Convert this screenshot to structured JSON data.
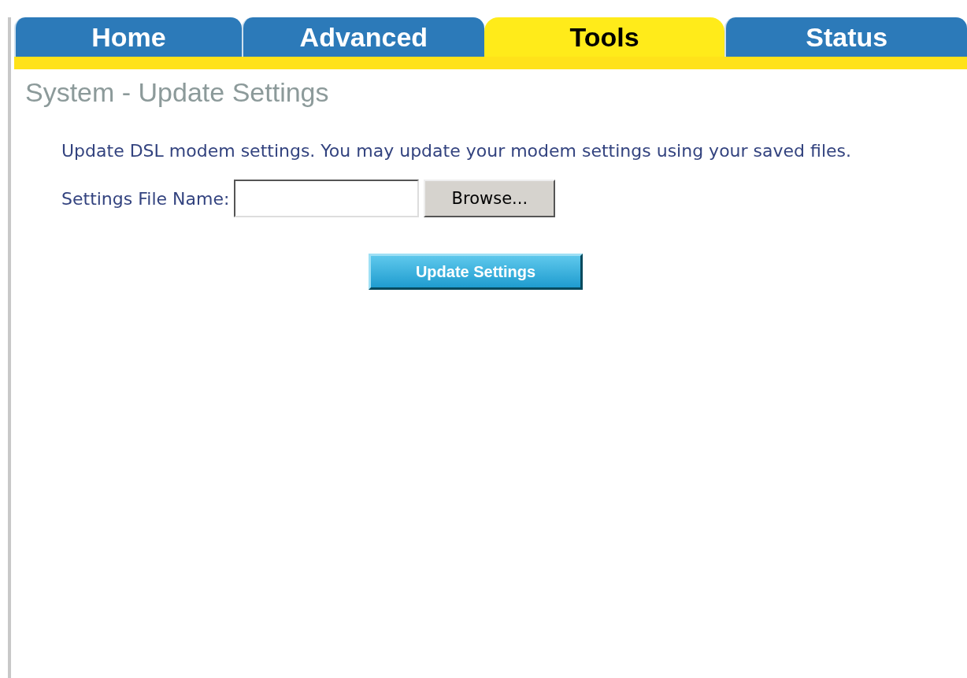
{
  "tabs": [
    {
      "label": "Home",
      "selected": false
    },
    {
      "label": "Advanced",
      "selected": false
    },
    {
      "label": "Tools",
      "selected": true
    },
    {
      "label": "Status",
      "selected": false
    }
  ],
  "page_title": "System - Update Settings",
  "description": "Update DSL modem settings. You may update your modem settings using your saved files.",
  "file_field": {
    "label": "Settings File Name:",
    "browse_button": "Browse..."
  },
  "update_button": "Update Settings"
}
